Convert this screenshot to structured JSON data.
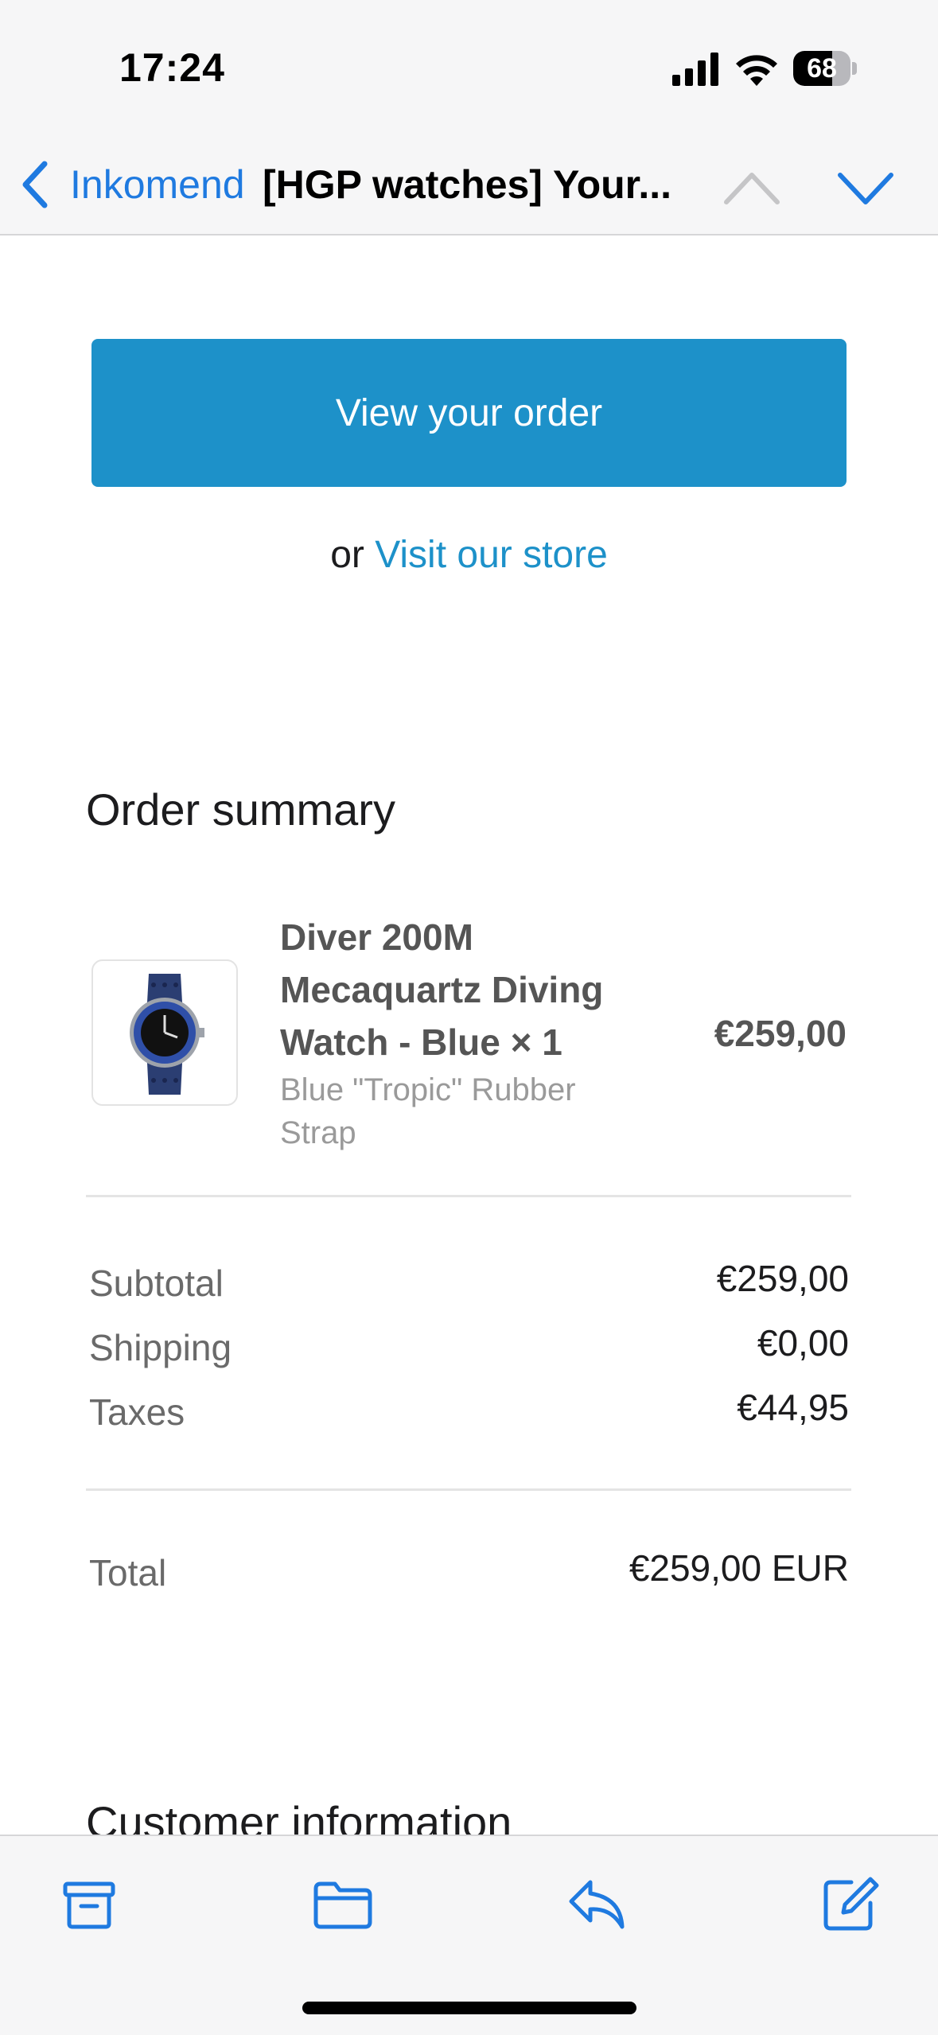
{
  "status_bar": {
    "time": "17:24",
    "battery": "68",
    "battery_level": 0.68
  },
  "nav": {
    "back_label": "Inkomend",
    "title": "[HGP watches] Your...",
    "icons": [
      "chevron-left-icon",
      "chevron-up-icon",
      "chevron-down-icon"
    ]
  },
  "email": {
    "cta_label": "View your order",
    "alt_prefix": "or",
    "alt_link": "Visit our store",
    "order_summary_title": "Order summary",
    "item": {
      "title": "Diver 200M Mecaquartz Diving Watch - Blue × 1",
      "variant": "Blue \"Tropic\" Rubber Strap",
      "price": "€259,00"
    },
    "totals": [
      {
        "label": "Subtotal",
        "value": "€259,00"
      },
      {
        "label": "Shipping",
        "value": "€0,00"
      },
      {
        "label": "Taxes",
        "value": "€44,95"
      }
    ],
    "total": {
      "label": "Total",
      "value": "€259,00 EUR"
    },
    "customer_info_title": "Customer information"
  },
  "toolbar": {
    "icons": [
      "archive-icon",
      "folder-icon",
      "reply-icon",
      "compose-icon"
    ]
  },
  "colors": {
    "link": "#1d91c9",
    "nav_accent": "#1f7ae0",
    "button": "#1d91c9"
  }
}
